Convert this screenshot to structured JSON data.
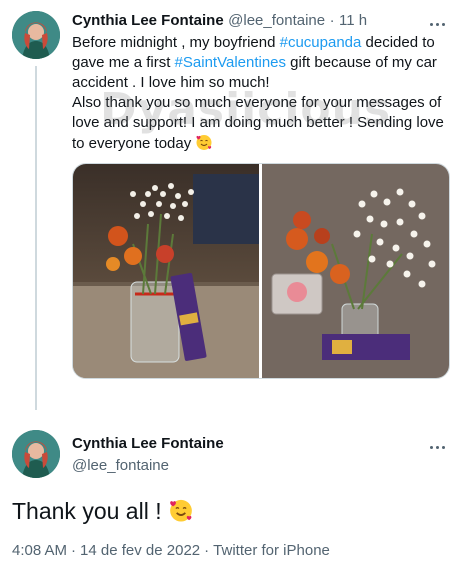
{
  "tweet1": {
    "display_name": "Cynthia Lee Fontaine",
    "handle": "@lee_fontaine",
    "time_sep": "·",
    "time": "11 h",
    "text_parts": {
      "p1": "Before midnight , my boyfriend ",
      "tag1": "#cucupanda",
      "p2": " decided to gave me a first ",
      "tag2": "#SaintValentines",
      "p3": " gift because of my car accident . I love him so much!",
      "p4": "Also thank you so much everyone for your messages of love and support!  I am doing much better !  Sending love to everyone today "
    },
    "watermark": "Dyasiicious",
    "emoji": "smiling-face-with-hearts-icon"
  },
  "tweet2": {
    "display_name": "Cynthia Lee Fontaine",
    "handle": "@lee_fontaine",
    "text": "Thank you all ! ",
    "timestamp": "4:08 AM",
    "date": "14 de fev de 2022",
    "source": "Twitter for iPhone",
    "sep": "·"
  },
  "colors": {
    "link": "#1d9bf0",
    "secondary": "#536471",
    "text": "#0f1419"
  }
}
